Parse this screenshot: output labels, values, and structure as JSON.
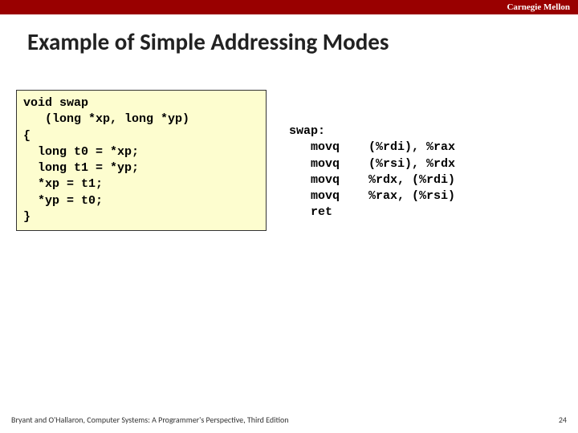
{
  "brand": "Carnegie Mellon",
  "title": "Example of Simple Addressing Modes",
  "c_code": "void swap\n   (long *xp, long *yp)\n{\n  long t0 = *xp;\n  long t1 = *yp;\n  *xp = t1;\n  *yp = t0;\n}",
  "asm_code": "swap:\n   movq    (%rdi), %rax\n   movq    (%rsi), %rdx\n   movq    %rdx, (%rdi)\n   movq    %rax, (%rsi)\n   ret",
  "footer_left": "Bryant and O'Hallaron, Computer Systems: A Programmer's Perspective, Third Edition",
  "footer_right": "24"
}
